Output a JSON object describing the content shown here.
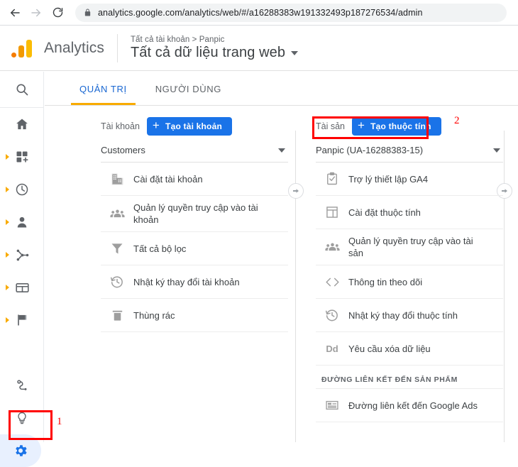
{
  "browser": {
    "url": "analytics.google.com/analytics/web/#/a16288383w191332493p187276534/admin",
    "back_icon": "arrow-left-icon",
    "forward_icon": "arrow-right-icon",
    "reload_icon": "reload-icon",
    "lock_icon": "lock-icon"
  },
  "header": {
    "brand": "Analytics",
    "breadcrumb": "Tất cả tài khoản > Panpic",
    "title": "Tất cả dữ liệu trang web",
    "logo_icon": "analytics-logo-icon",
    "caret_icon": "chevron-down-icon"
  },
  "rail": {
    "items": [
      {
        "name": "search-icon",
        "label": "search",
        "expandable": false
      },
      {
        "name": "home-icon",
        "label": "home",
        "expandable": false
      },
      {
        "name": "customization-icon",
        "label": "customization",
        "expandable": true
      },
      {
        "name": "realtime-clock-icon",
        "label": "realtime",
        "expandable": true
      },
      {
        "name": "audience-person-icon",
        "label": "audience",
        "expandable": true
      },
      {
        "name": "acquisition-share-icon",
        "label": "acquisition",
        "expandable": true
      },
      {
        "name": "behavior-window-icon",
        "label": "behavior",
        "expandable": true
      },
      {
        "name": "conversions-flag-icon",
        "label": "conversions",
        "expandable": true
      },
      {
        "name": "attribution-path-icon",
        "label": "attribution",
        "expandable": false
      },
      {
        "name": "discover-bulb-icon",
        "label": "discover",
        "expandable": false
      },
      {
        "name": "gear-icon",
        "label": "admin",
        "expandable": false,
        "active": true
      }
    ]
  },
  "tabs": [
    {
      "label": "QUẢN TRỊ",
      "active": true
    },
    {
      "label": "NGƯỜI DÙNG",
      "active": false
    }
  ],
  "account_column": {
    "head_label": "Tài khoản",
    "create_button": "Tạo tài khoản",
    "plus": "+",
    "selected": "Customers",
    "items": [
      {
        "icon": "building-icon",
        "label": "Cài đặt tài khoản"
      },
      {
        "icon": "people-group-icon",
        "label": "Quản lý quyền truy cập vào tài khoản"
      },
      {
        "icon": "filter-funnel-icon",
        "label": "Tất cả bộ lọc"
      },
      {
        "icon": "history-clock-icon",
        "label": "Nhật ký thay đổi tài khoản"
      },
      {
        "icon": "trash-icon",
        "label": "Thùng rác"
      }
    ]
  },
  "property_column": {
    "head_label": "Tài sản",
    "create_button": "Tạo thuộc tính",
    "plus": "+",
    "selected": "Panpic (UA-16288383-15)",
    "items": [
      {
        "icon": "clipboard-check-icon",
        "label": "Trợ lý thiết lập GA4"
      },
      {
        "icon": "layout-window-icon",
        "label": "Cài đặt thuộc tính"
      },
      {
        "icon": "people-group-icon",
        "label": "Quản lý quyền truy cập vào tài sản"
      },
      {
        "icon": "code-brackets-icon",
        "label": "Thông tin theo dõi"
      },
      {
        "icon": "history-clock-icon",
        "label": "Nhật ký thay đổi thuộc tính"
      },
      {
        "icon": "dd-text-icon",
        "label": "Yêu cầu xóa dữ liệu"
      }
    ],
    "section_title": "ĐƯỜNG LIÊN KẾT ĐẾN SẢN PHẨM",
    "section_items": [
      {
        "icon": "google-ads-link-icon",
        "label": "Đường liên kết đến Google Ads"
      }
    ]
  },
  "scroll_arrows": {
    "left_arrow_icon": "arrow-right-circle-icon",
    "right_arrow_icon": "arrow-right-circle-icon"
  },
  "annotations": [
    {
      "number": "1",
      "target": "gear-icon",
      "color": "#ff0000"
    },
    {
      "number": "2",
      "target": "create-property-button",
      "color": "#ff0000"
    }
  ],
  "colors": {
    "brand_blue": "#1a73e8",
    "tab_active": "#1967d2",
    "tab_underline": "#f9ab00",
    "annotation_red": "#ff0000",
    "text_primary": "#3c4043",
    "text_secondary": "#5f6368"
  }
}
